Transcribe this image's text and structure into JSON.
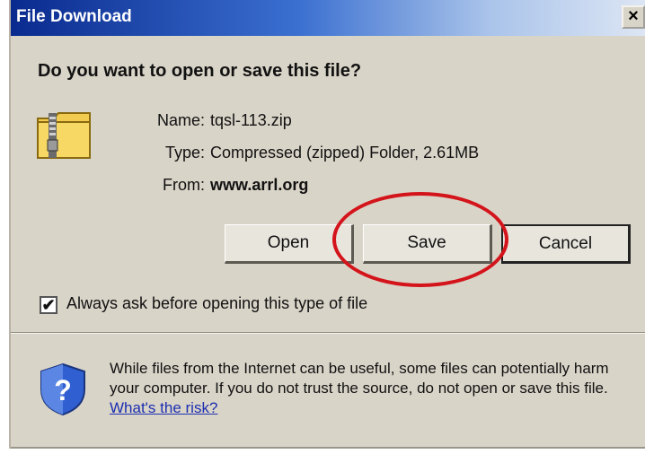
{
  "window": {
    "title": "File Download",
    "close_glyph": "×"
  },
  "prompt": {
    "question": "Do you want to open or save this file?"
  },
  "file": {
    "icon": "zip-folder-icon",
    "name_label": "Name:",
    "name_value": "tqsl-113.zip",
    "type_label": "Type:",
    "type_value": "Compressed (zipped) Folder, 2.61MB",
    "from_label": "From:",
    "from_value": "www.arrl.org"
  },
  "buttons": {
    "open": "Open",
    "save": "Save",
    "cancel": "Cancel"
  },
  "highlight": {
    "target": "save",
    "color": "#d4141b"
  },
  "always_ask": {
    "checked": true,
    "check_glyph": "✔",
    "label": "Always ask before opening this type of file"
  },
  "warning": {
    "icon": "security-shield-icon",
    "text": "While files from the Internet can be useful, some files can potentially harm your computer. If you do not trust the source, do not open or save this file.",
    "link": "What's the risk?"
  },
  "colors": {
    "title_bar": "#0a2a8e",
    "dialog_bg": "#d9d4c8",
    "link": "#1c2fb0"
  }
}
